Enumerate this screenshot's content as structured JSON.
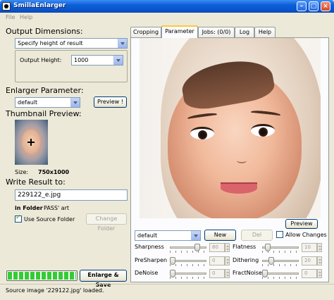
{
  "window": {
    "title": "SmillaEnlarger"
  },
  "menu": {
    "items": [
      "File",
      "Help"
    ]
  },
  "left": {
    "output_dimensions": {
      "heading": "Output Dimensions:",
      "mode_selected": "Specify height of result",
      "height_label": "Output Height:",
      "height_value": "1000"
    },
    "enlarger": {
      "heading": "Enlarger Parameter:",
      "preset_selected": "default",
      "preview_button": "Preview !"
    },
    "thumbnail": {
      "heading": "Thumbnail Preview:",
      "size_label": "Size:",
      "size_value": "750x1000"
    },
    "write_result": {
      "heading": "Write Result to:",
      "filename": "229122_e.jpg",
      "in_folder_label": "in Folder",
      "folder_value": "PASS' art",
      "use_source_label": "Use Source Folder",
      "use_source_checked": true,
      "change_folder_button": "Change Folder"
    },
    "progress": {
      "fraction": 1.0
    },
    "enlarge_button": "Enlarge & Save"
  },
  "status": {
    "text": "Source image '229122.jpg' loaded."
  },
  "tabs": [
    "Cropping",
    "Parameter",
    "Jobs: (0/0)",
    "Log",
    "Help"
  ],
  "active_tab": 1,
  "parameter_panel": {
    "preview_button": "Preview",
    "preset_selected": "default",
    "new_button": "New",
    "del_button": "Del",
    "allow_changes_label": "Allow Changes",
    "allow_changes_checked": false,
    "params": [
      {
        "label": "Sharpness",
        "value": "80",
        "level": 0.8
      },
      {
        "label": "Flatness",
        "value": "10",
        "level": 0.1
      },
      {
        "label": "PreSharpen",
        "value": "0",
        "level": 0.0
      },
      {
        "label": "Dithering",
        "value": "20",
        "level": 0.2
      },
      {
        "label": "DeNoise",
        "value": "0",
        "level": 0.0
      },
      {
        "label": "FractNoise",
        "value": "0",
        "level": 0.0
      }
    ]
  },
  "colors": {
    "titlebar": "#0b5fd8",
    "progress": "#33cc33",
    "tab_highlight": "#ffc83c"
  }
}
